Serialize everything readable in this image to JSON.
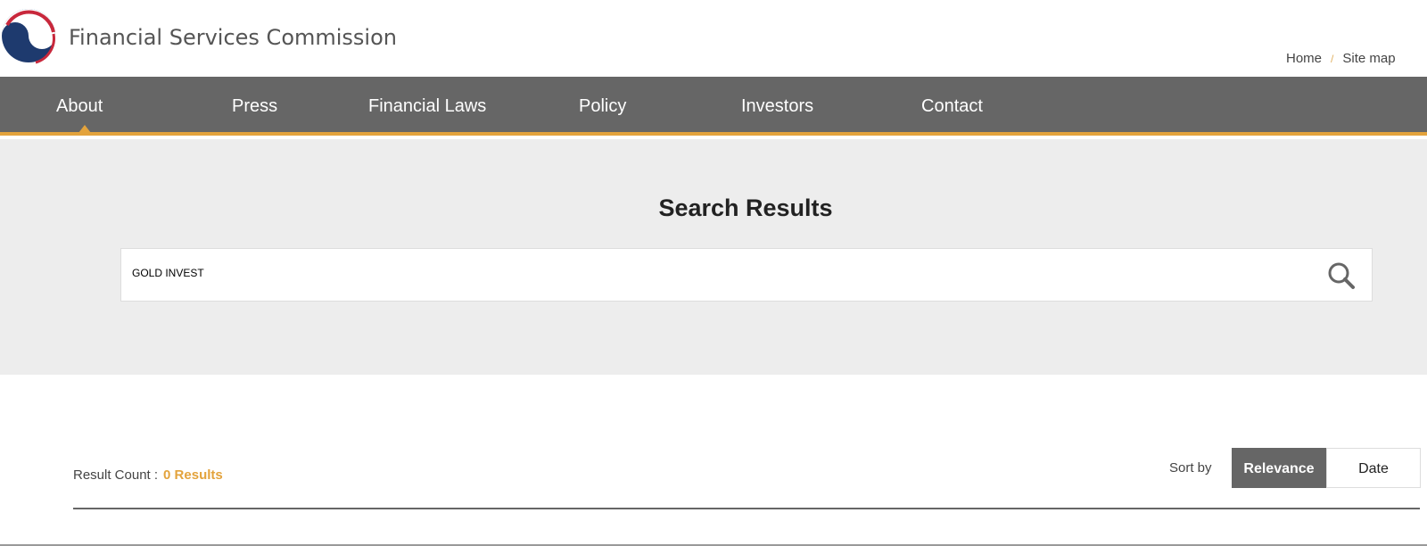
{
  "header": {
    "brand": "Financial Services Commission",
    "util_links": [
      "Home",
      "Site map"
    ]
  },
  "nav": {
    "items": [
      "About",
      "Press",
      "Financial Laws",
      "Policy",
      "Investors",
      "Contact"
    ],
    "active": "About"
  },
  "search": {
    "title": "Search Results",
    "query": "GOLD INVEST",
    "icon": "search-icon"
  },
  "results": {
    "count_label": "Result Count :",
    "count_value": "0 Results",
    "sort_label": "Sort by",
    "sort_options": [
      "Relevance",
      "Date"
    ],
    "selected_sort": "Relevance"
  },
  "colors": {
    "accent": "#e3a33c",
    "nav_bg": "#666666",
    "hero_bg": "#ededed"
  }
}
